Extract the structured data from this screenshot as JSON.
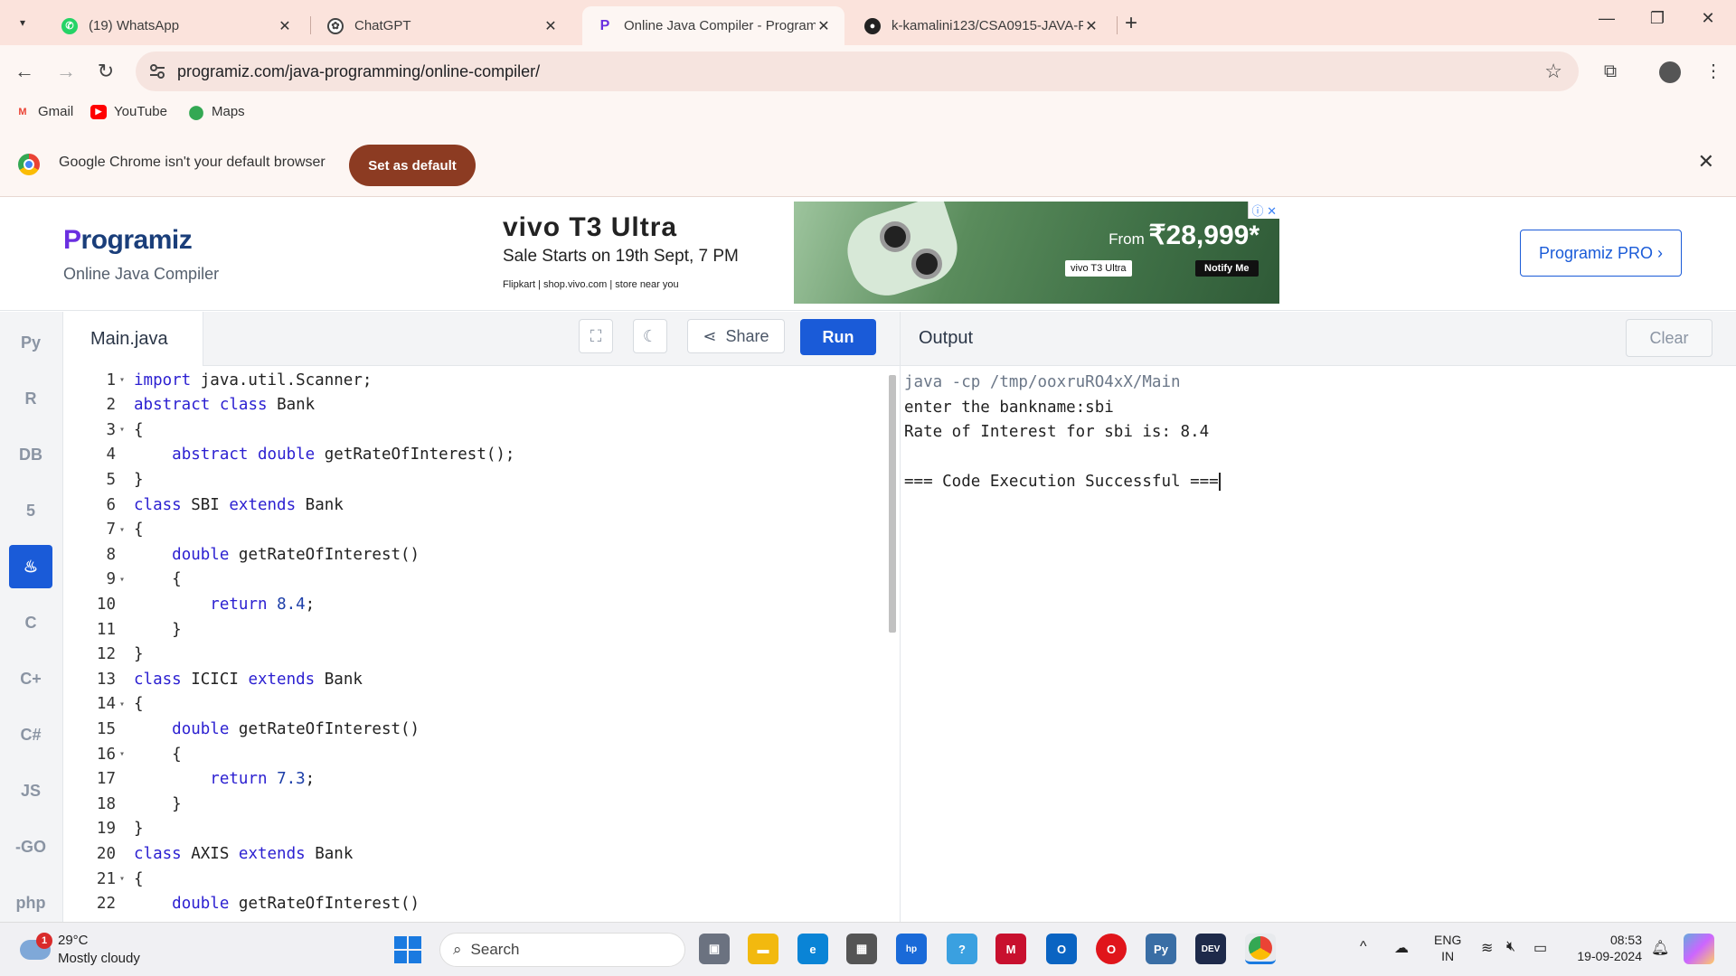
{
  "browser": {
    "tabs": [
      {
        "title": "(19) WhatsApp",
        "icon": "whatsapp-icon",
        "active": false
      },
      {
        "title": "ChatGPT",
        "icon": "chatgpt-icon",
        "active": false
      },
      {
        "title": "Online Java Compiler - Program",
        "icon": "programiz-icon",
        "active": true
      },
      {
        "title": "k-kamalini123/CSA0915-JAVA-P",
        "icon": "github-icon",
        "active": false
      }
    ],
    "url": "programiz.com/java-programming/online-compiler/",
    "bookmarks": [
      {
        "label": "Gmail",
        "icon": "gmail-icon"
      },
      {
        "label": "YouTube",
        "icon": "youtube-icon"
      },
      {
        "label": "Maps",
        "icon": "maps-icon"
      }
    ],
    "infobar": {
      "message": "Google Chrome isn't your default browser",
      "button": "Set as default"
    }
  },
  "site": {
    "logo": "rogramiz",
    "logo_initial": "P",
    "subtitle": "Online Java Compiler",
    "pro_button": "Programiz PRO ›",
    "ad": {
      "brand": "vivo T3 Ultra",
      "sale": "Sale Starts on 19th Sept, 7 PM",
      "stores": "Flipkart | shop.vivo.com | store near you",
      "price_prefix": "From",
      "price": "₹28,999*",
      "tag": "vivo T3 Ultra",
      "notify": "Notify Me"
    }
  },
  "editor": {
    "filename": "Main.java",
    "share_label": "Share",
    "run_label": "Run",
    "lines": [
      {
        "n": "1",
        "fold": true,
        "segs": [
          [
            "kw",
            "import"
          ],
          [
            "t",
            " java.util.Scanner;"
          ]
        ]
      },
      {
        "n": "2",
        "fold": false,
        "segs": [
          [
            "kw",
            "abstract"
          ],
          [
            "t",
            " "
          ],
          [
            "kw",
            "class"
          ],
          [
            "t",
            " Bank"
          ]
        ]
      },
      {
        "n": "3",
        "fold": true,
        "segs": [
          [
            "t",
            "{"
          ]
        ]
      },
      {
        "n": "4",
        "fold": false,
        "segs": [
          [
            "t",
            "    "
          ],
          [
            "kw",
            "abstract"
          ],
          [
            "t",
            " "
          ],
          [
            "kw",
            "double"
          ],
          [
            "t",
            " getRateOfInterest();"
          ]
        ]
      },
      {
        "n": "5",
        "fold": false,
        "segs": [
          [
            "t",
            "}"
          ]
        ]
      },
      {
        "n": "6",
        "fold": false,
        "segs": [
          [
            "kw",
            "class"
          ],
          [
            "t",
            " SBI "
          ],
          [
            "kw",
            "extends"
          ],
          [
            "t",
            " Bank"
          ]
        ]
      },
      {
        "n": "7",
        "fold": true,
        "segs": [
          [
            "t",
            "{"
          ]
        ]
      },
      {
        "n": "8",
        "fold": false,
        "segs": [
          [
            "t",
            "    "
          ],
          [
            "kw",
            "double"
          ],
          [
            "t",
            " getRateOfInterest()"
          ]
        ]
      },
      {
        "n": "9",
        "fold": true,
        "segs": [
          [
            "t",
            "    {"
          ]
        ]
      },
      {
        "n": "10",
        "fold": false,
        "segs": [
          [
            "t",
            "        "
          ],
          [
            "kw",
            "return"
          ],
          [
            "t",
            " "
          ],
          [
            "num",
            "8.4"
          ],
          [
            "t",
            ";"
          ]
        ]
      },
      {
        "n": "11",
        "fold": false,
        "segs": [
          [
            "t",
            "    }"
          ]
        ]
      },
      {
        "n": "12",
        "fold": false,
        "segs": [
          [
            "t",
            "}"
          ]
        ]
      },
      {
        "n": "13",
        "fold": false,
        "segs": [
          [
            "kw",
            "class"
          ],
          [
            "t",
            " ICICI "
          ],
          [
            "kw",
            "extends"
          ],
          [
            "t",
            " Bank"
          ]
        ]
      },
      {
        "n": "14",
        "fold": true,
        "segs": [
          [
            "t",
            "{"
          ]
        ]
      },
      {
        "n": "15",
        "fold": false,
        "segs": [
          [
            "t",
            "    "
          ],
          [
            "kw",
            "double"
          ],
          [
            "t",
            " getRateOfInterest()"
          ]
        ]
      },
      {
        "n": "16",
        "fold": true,
        "segs": [
          [
            "t",
            "    {"
          ]
        ]
      },
      {
        "n": "17",
        "fold": false,
        "segs": [
          [
            "t",
            "        "
          ],
          [
            "kw",
            "return"
          ],
          [
            "t",
            " "
          ],
          [
            "num",
            "7.3"
          ],
          [
            "t",
            ";"
          ]
        ]
      },
      {
        "n": "18",
        "fold": false,
        "segs": [
          [
            "t",
            "    }"
          ]
        ]
      },
      {
        "n": "19",
        "fold": false,
        "segs": [
          [
            "t",
            "}"
          ]
        ]
      },
      {
        "n": "20",
        "fold": false,
        "segs": [
          [
            "kw",
            "class"
          ],
          [
            "t",
            " AXIS "
          ],
          [
            "kw",
            "extends"
          ],
          [
            "t",
            " Bank"
          ]
        ]
      },
      {
        "n": "21",
        "fold": true,
        "segs": [
          [
            "t",
            "{"
          ]
        ]
      },
      {
        "n": "22",
        "fold": false,
        "segs": [
          [
            "t",
            "    "
          ],
          [
            "kw",
            "double"
          ],
          [
            "t",
            " getRateOfInterest()"
          ]
        ]
      }
    ]
  },
  "output": {
    "title": "Output",
    "clear_label": "Clear",
    "lines": [
      {
        "text": "java -cp /tmp/ooxruRO4xX/Main",
        "cmd": true
      },
      {
        "text": "enter the bankname:sbi",
        "cmd": false
      },
      {
        "text": "Rate of Interest for sbi is: 8.4",
        "cmd": false
      },
      {
        "text": "",
        "cmd": false
      },
      {
        "text": "=== Code Execution Successful ===",
        "cmd": false
      }
    ]
  },
  "rail": [
    {
      "name": "python",
      "label": "Py"
    },
    {
      "name": "r",
      "label": "R"
    },
    {
      "name": "sql",
      "label": "DB"
    },
    {
      "name": "html",
      "label": "5"
    },
    {
      "name": "java",
      "label": "♨",
      "active": true
    },
    {
      "name": "c",
      "label": "C"
    },
    {
      "name": "cpp",
      "label": "C+"
    },
    {
      "name": "csharp",
      "label": "C#"
    },
    {
      "name": "javascript",
      "label": "JS"
    },
    {
      "name": "go",
      "label": "-GO"
    },
    {
      "name": "php",
      "label": "php"
    }
  ],
  "taskbar": {
    "weather_temp": "29°C",
    "weather_cond": "Mostly cloudy",
    "weather_badge": "1",
    "search_placeholder": "Search",
    "lang_top": "ENG",
    "lang_bottom": "IN",
    "time": "08:53",
    "date": "19-09-2024"
  }
}
